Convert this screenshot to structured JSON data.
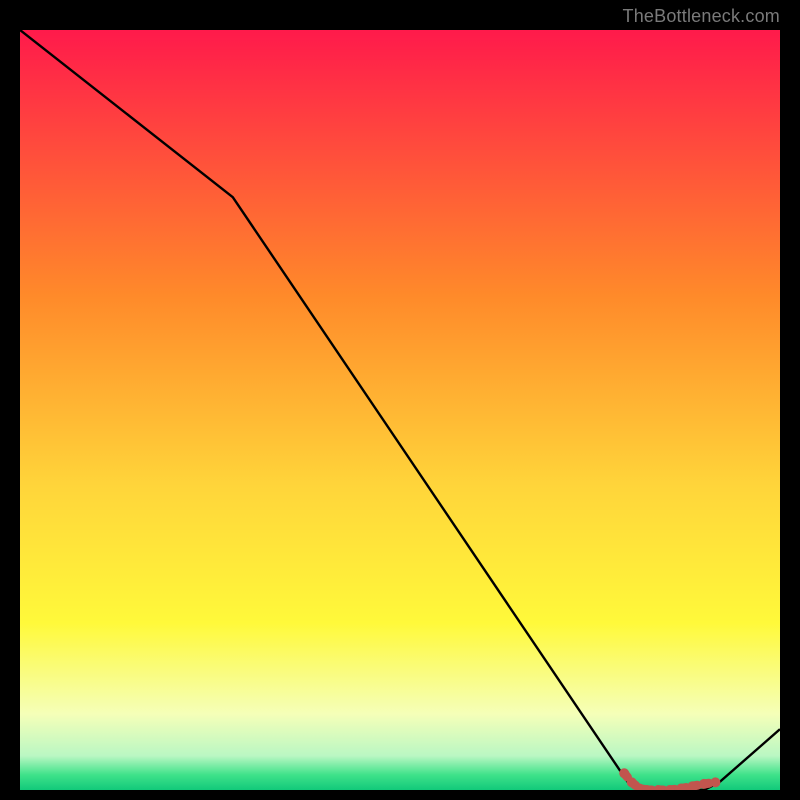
{
  "attribution": "TheBottleneck.com",
  "chart_data": {
    "type": "line",
    "title": "",
    "xlabel": "",
    "ylabel": "",
    "x": [
      0.0,
      0.28,
      0.8,
      0.82,
      0.9,
      0.92,
      1.0
    ],
    "values": [
      1.0,
      0.78,
      0.01,
      0.0,
      0.0,
      0.01,
      0.08
    ],
    "xlim": [
      0,
      1
    ],
    "ylim": [
      0,
      1
    ],
    "gradient_stops": [
      {
        "pos": 0.0,
        "color": "#ff1a4b"
      },
      {
        "pos": 0.35,
        "color": "#ff8a2a"
      },
      {
        "pos": 0.6,
        "color": "#ffd53a"
      },
      {
        "pos": 0.78,
        "color": "#fff93a"
      },
      {
        "pos": 0.9,
        "color": "#f5ffb8"
      },
      {
        "pos": 0.955,
        "color": "#baf7c3"
      },
      {
        "pos": 0.98,
        "color": "#3fe28a"
      },
      {
        "pos": 1.0,
        "color": "#11c97a"
      }
    ],
    "marker_segment": {
      "color": "#c1554e",
      "points": [
        {
          "x": 0.795,
          "y": 0.022
        },
        {
          "x": 0.805,
          "y": 0.01
        },
        {
          "x": 0.815,
          "y": 0.002
        },
        {
          "x": 0.825,
          "y": 0.0
        },
        {
          "x": 0.84,
          "y": 0.0
        },
        {
          "x": 0.855,
          "y": 0.0
        },
        {
          "x": 0.87,
          "y": 0.002
        },
        {
          "x": 0.885,
          "y": 0.005
        },
        {
          "x": 0.9,
          "y": 0.008
        },
        {
          "x": 0.915,
          "y": 0.01
        }
      ]
    }
  }
}
